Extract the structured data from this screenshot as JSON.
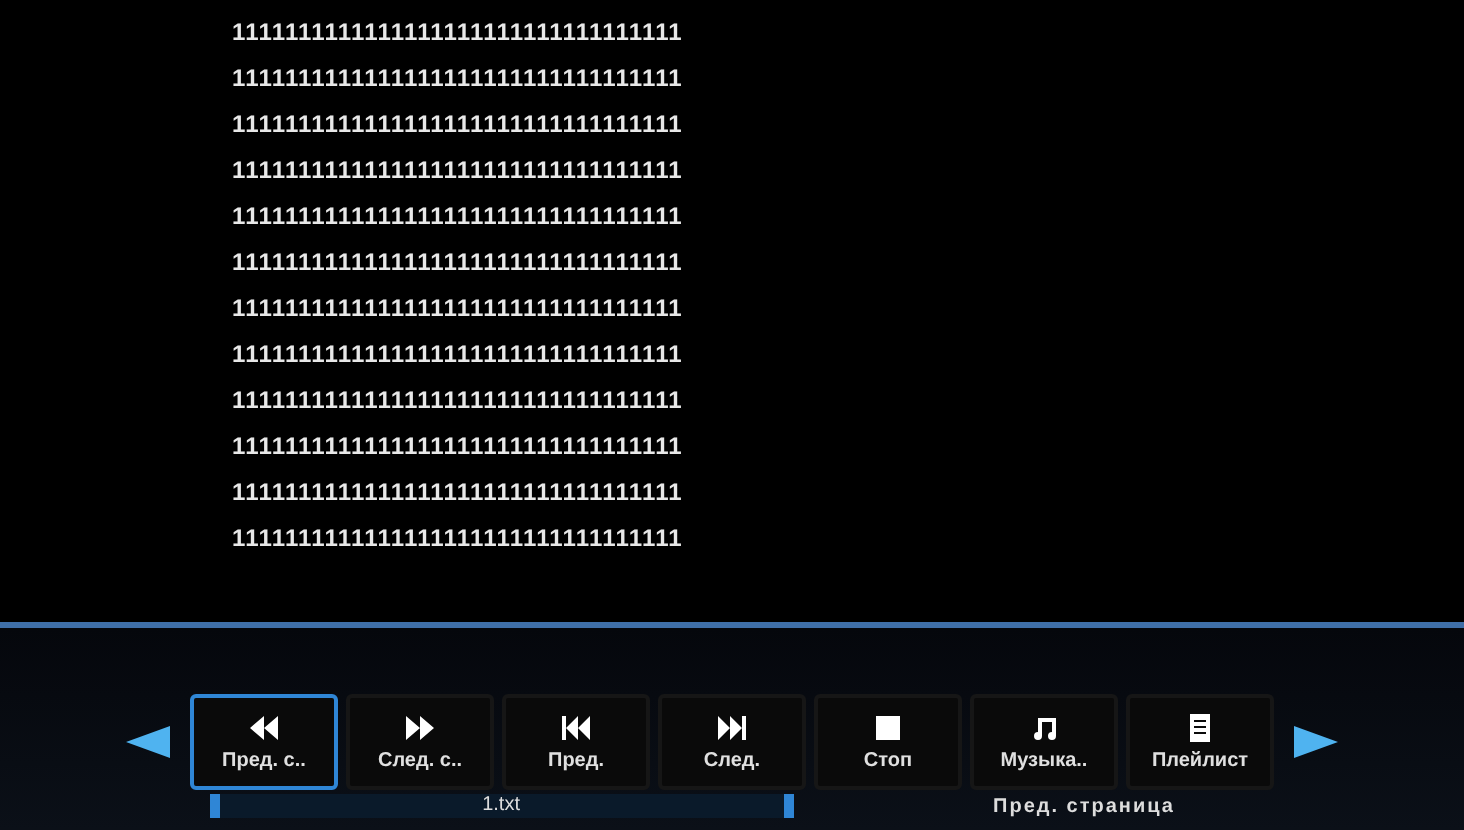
{
  "text_lines": [
    "1111111111111111111111111111111111",
    "1111111111111111111111111111111111",
    "1111111111111111111111111111111111",
    "1111111111111111111111111111111111",
    "1111111111111111111111111111111111",
    "1111111111111111111111111111111111",
    "1111111111111111111111111111111111",
    "1111111111111111111111111111111111",
    "1111111111111111111111111111111111",
    "1111111111111111111111111111111111",
    "1111111111111111111111111111111111",
    "1111111111111111111111111111111111"
  ],
  "controls": [
    {
      "kind": "rewind",
      "label": "Пред. с..",
      "selected": true
    },
    {
      "kind": "forward",
      "label": "След. с..",
      "selected": false
    },
    {
      "kind": "prev",
      "label": "Пред.",
      "selected": false
    },
    {
      "kind": "next",
      "label": "След.",
      "selected": false
    },
    {
      "kind": "stop",
      "label": "Стоп",
      "selected": false
    },
    {
      "kind": "music",
      "label": "Музыка..",
      "selected": false
    },
    {
      "kind": "playlist",
      "label": "Плейлист",
      "selected": false
    }
  ],
  "file_name": "1.txt",
  "page_hint": "Пред. страница"
}
